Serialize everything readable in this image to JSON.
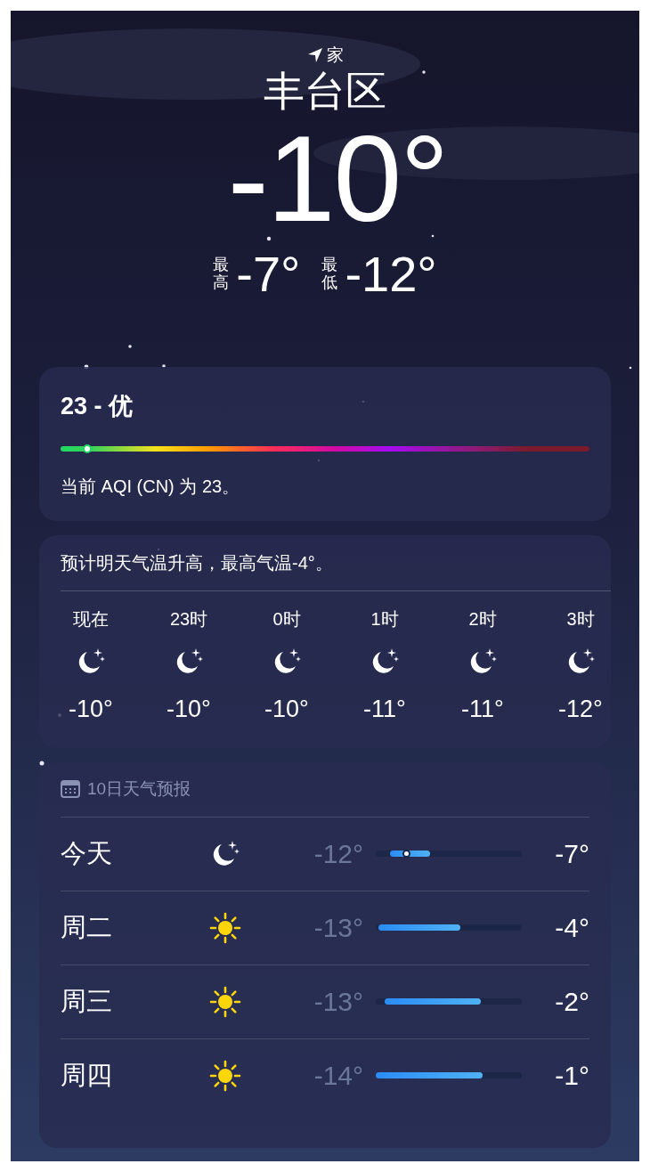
{
  "location": {
    "label": "家",
    "city": "丰台区"
  },
  "current": {
    "temperature": "-10°",
    "high_label": "最高",
    "high": "-7°",
    "low_label": "最低",
    "low": "-12°"
  },
  "aqi": {
    "title": "23 - 优",
    "level": 0.05,
    "description": "当前 AQI (CN) 为 23。"
  },
  "hourly": {
    "summary": "预计明天气温升高，最高气温-4°。",
    "hours": [
      {
        "time": "现在",
        "kind": "moon",
        "temp": "-10°"
      },
      {
        "time": "23时",
        "kind": "moon",
        "temp": "-10°"
      },
      {
        "time": "0时",
        "kind": "moon",
        "temp": "-10°"
      },
      {
        "time": "1时",
        "kind": "moon",
        "temp": "-11°"
      },
      {
        "time": "2时",
        "kind": "moon",
        "temp": "-11°"
      },
      {
        "time": "3时",
        "kind": "moon",
        "temp": "-12°"
      }
    ]
  },
  "daily": {
    "title": "10日天气预报",
    "days": [
      {
        "day": "今天",
        "kind": "moon",
        "low": "-12°",
        "high": "-7°",
        "now": {
          "level": 0.21
        }
      },
      {
        "day": "周二",
        "kind": "sun",
        "low": "-13°",
        "high": "-4°"
      },
      {
        "day": "周三",
        "kind": "sun",
        "low": "-13°",
        "high": "-2°"
      },
      {
        "day": "周四",
        "kind": "sun",
        "low": "-14°",
        "high": "-1°"
      }
    ]
  }
}
